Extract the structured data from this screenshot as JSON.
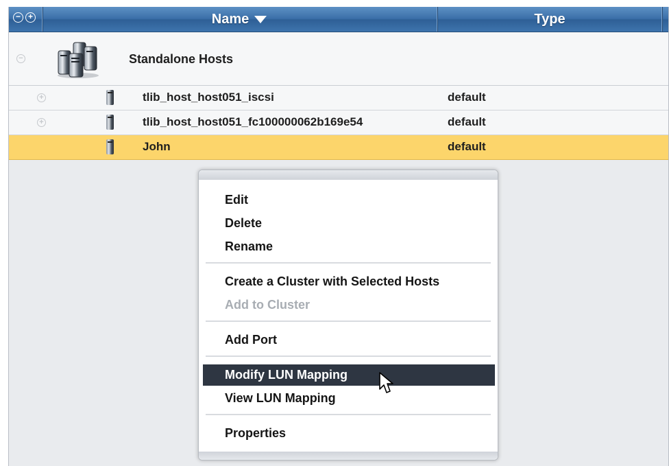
{
  "table": {
    "header": {
      "columns": [
        {
          "label": "Name",
          "sorted": "descending"
        },
        {
          "label": "Type"
        }
      ],
      "controls": [
        "collapse-all-icon",
        "expand-all-icon"
      ]
    },
    "group": {
      "label": "Standalone Hosts",
      "icon": "server-cluster-icon",
      "expanded": true
    },
    "rows": [
      {
        "name": "tlib_host_host051_iscsi",
        "type": "default",
        "selected": false,
        "icon": "server-icon"
      },
      {
        "name": "tlib_host_host051_fc100000062b169e54",
        "type": "default",
        "selected": false,
        "icon": "server-icon"
      },
      {
        "name": "John",
        "type": "default",
        "selected": true,
        "icon": "server-icon"
      }
    ]
  },
  "context_menu": {
    "items": [
      {
        "label": "Edit",
        "enabled": true
      },
      {
        "label": "Delete",
        "enabled": true
      },
      {
        "label": "Rename",
        "enabled": true
      },
      {
        "label": "Create a Cluster with Selected Hosts",
        "enabled": true
      },
      {
        "label": "Add to Cluster",
        "enabled": false
      },
      {
        "label": "Add Port",
        "enabled": true
      },
      {
        "label": "Modify LUN Mapping",
        "enabled": true,
        "highlighted": true
      },
      {
        "label": "View LUN Mapping",
        "enabled": true
      },
      {
        "label": "Properties",
        "enabled": true
      }
    ]
  },
  "colors": {
    "header": "#3a6fa8",
    "selected_row": "#fcd56b",
    "menu_highlight": "#2e3642",
    "disabled_text": "#a8adb3"
  }
}
